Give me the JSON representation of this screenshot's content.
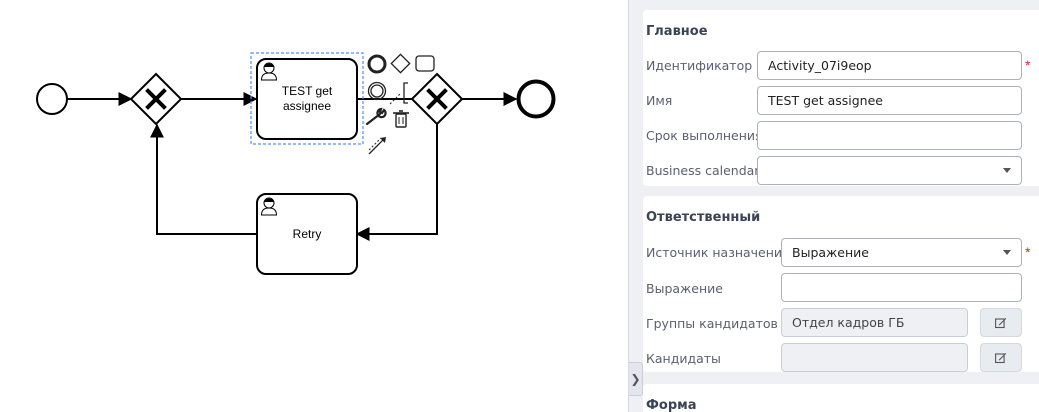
{
  "diagram": {
    "task_main_label_line1": "TEST get",
    "task_main_label_line2": "assignee",
    "task_retry_label": "Retry"
  },
  "panel": {
    "main": {
      "title": "Главное",
      "id_label": "Идентификатор",
      "id_value": "Activity_07i9eop",
      "name_label": "Имя",
      "name_value": "TEST get assignee",
      "due_label": "Срок выполнения",
      "due_value": "",
      "calendar_label": "Business calendar",
      "calendar_value": ""
    },
    "assignee": {
      "title": "Ответственный",
      "source_label": "Источник назначения",
      "source_value": "Выражение",
      "expression_label": "Выражение",
      "expression_value": "",
      "groups_label": "Группы кандидатов",
      "groups_value": "Отдел кадров ГБ",
      "candidates_label": "Кандидаты",
      "candidates_value": ""
    },
    "form": {
      "title": "Форма"
    },
    "required_mark": "*"
  },
  "colors": {
    "accent_required": "#e02424",
    "selection": "#4d90fe",
    "panel_bg": "#eef0f4"
  }
}
